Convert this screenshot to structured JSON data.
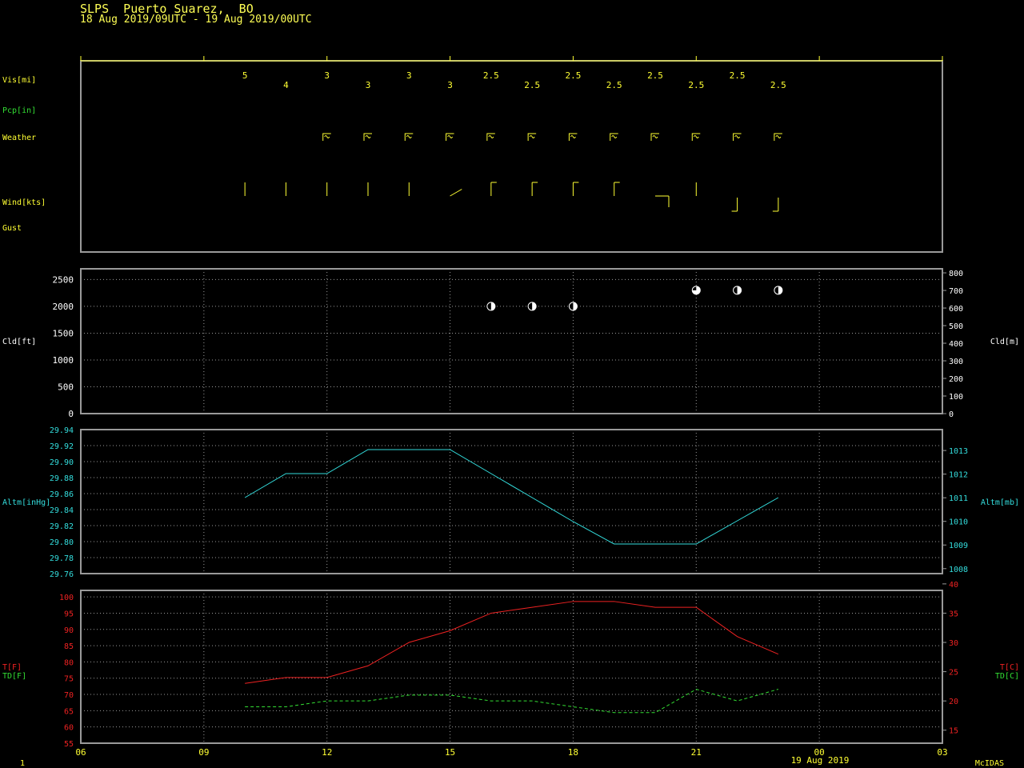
{
  "header": {
    "title": "SLPS  Puerto Suarez,  BO",
    "subtitle": "18 Aug 2019/09UTC - 19 Aug 2019/00UTC"
  },
  "footer": {
    "page": "1",
    "brand": "McIDAS",
    "date_label": "19 Aug 2019"
  },
  "colors": {
    "frame": "#9a9a9a",
    "grid": "#9a9a9a",
    "yellow": "#ffff33",
    "green": "#33dd33",
    "cyan": "#33dddd",
    "red": "#ee2222",
    "white": "#ffffff"
  },
  "chart_data": [
    {
      "type": "table",
      "panel": "surface observations",
      "time_axis": {
        "labels": [
          "06",
          "09",
          "12",
          "15",
          "18",
          "21",
          "00",
          "03"
        ],
        "xlim": [
          6,
          27
        ]
      },
      "rows": [
        "Vis[mi]",
        "Pcp[in]",
        "Weather",
        "Wind[kts]",
        "Gust"
      ],
      "visibility": {
        "x": [
          10,
          11,
          12,
          13,
          14,
          15,
          16,
          17,
          18,
          19,
          20,
          21,
          22,
          23
        ],
        "values": [
          "5",
          "4",
          "3",
          "3",
          "3",
          "3",
          "2.5",
          "2.5",
          "2.5",
          "2.5",
          "2.5",
          "2.5",
          "2.5",
          "2.5"
        ]
      },
      "weather": {
        "x": [
          12,
          13,
          14,
          15,
          16,
          17,
          18,
          19,
          20,
          21,
          22,
          23
        ],
        "symbol": "haze"
      },
      "wind": {
        "x": [
          10,
          11,
          12,
          13,
          14,
          15,
          16,
          17,
          18,
          19,
          20,
          21,
          22,
          23
        ],
        "direction_deg": [
          360,
          360,
          360,
          360,
          360,
          60,
          360,
          360,
          360,
          360,
          90,
          360,
          180,
          180
        ],
        "speed_kts": [
          0,
          0,
          0,
          0,
          0,
          0,
          5,
          5,
          5,
          5,
          10,
          0,
          5,
          5
        ]
      }
    },
    {
      "type": "scatter",
      "ylabel": "Cld[ft]",
      "ylabel_right": "Cld[m]",
      "ylim": [
        0,
        2700
      ],
      "ylim_right": [
        0,
        823
      ],
      "yticks": [
        0,
        500,
        1000,
        1500,
        2000,
        2500
      ],
      "yticks_right": [
        0,
        100,
        200,
        300,
        400,
        500,
        600,
        700,
        800
      ],
      "points": [
        {
          "x": 16,
          "y": 2000,
          "cover": "scattered"
        },
        {
          "x": 17,
          "y": 2000,
          "cover": "scattered"
        },
        {
          "x": 18,
          "y": 2000,
          "cover": "scattered"
        },
        {
          "x": 21,
          "y": 2300,
          "cover": "broken"
        },
        {
          "x": 22,
          "y": 2300,
          "cover": "scattered"
        },
        {
          "x": 23,
          "y": 2300,
          "cover": "scattered"
        }
      ]
    },
    {
      "type": "line",
      "ylabel": "Altm[inHg]",
      "ylabel_right": "Altm[mb]",
      "ylim": [
        29.76,
        29.94
      ],
      "yticks": [
        "29.76",
        "29.78",
        "29.80",
        "29.82",
        "29.84",
        "29.86",
        "29.88",
        "29.90",
        "29.92",
        "29.94"
      ],
      "yticks_right": [
        "1008",
        "1009",
        "1010",
        "1011",
        "1012",
        "1013"
      ],
      "series": [
        {
          "x": [
            10,
            11,
            12,
            13,
            14,
            15,
            16,
            17,
            18,
            19,
            20,
            21,
            22,
            23
          ],
          "values": [
            29.855,
            29.885,
            29.885,
            29.915,
            29.915,
            29.915,
            29.885,
            29.855,
            29.825,
            29.797,
            29.797,
            29.797,
            29.826,
            29.855
          ]
        }
      ]
    },
    {
      "type": "line",
      "ylabel": "T[F]",
      "ylabel2": "TD[F]",
      "ylabel_right": "T[C]",
      "ylabel_right2": "TD[C]",
      "ylim": [
        55,
        102
      ],
      "yticks": [
        55,
        60,
        65,
        70,
        75,
        80,
        85,
        90,
        95,
        100
      ],
      "yticks_right": [
        15,
        20,
        25,
        30,
        35,
        40
      ],
      "series": [
        {
          "label": "T[F]",
          "x": [
            10,
            11,
            12,
            13,
            14,
            15,
            16,
            17,
            18,
            19,
            20,
            21,
            22,
            23
          ],
          "values": [
            73.4,
            75.2,
            75.2,
            78.8,
            86,
            89.6,
            95,
            96.8,
            98.6,
            98.6,
            96.8,
            96.8,
            87.8,
            82.4
          ]
        },
        {
          "label": "TD[F]",
          "x": [
            10,
            11,
            12,
            13,
            14,
            15,
            16,
            17,
            18,
            19,
            20,
            21,
            22,
            23
          ],
          "values": [
            66.2,
            66.2,
            68,
            68,
            69.8,
            69.8,
            68,
            68,
            66.2,
            64.4,
            64.4,
            71.6,
            68,
            71.6
          ]
        }
      ]
    }
  ]
}
